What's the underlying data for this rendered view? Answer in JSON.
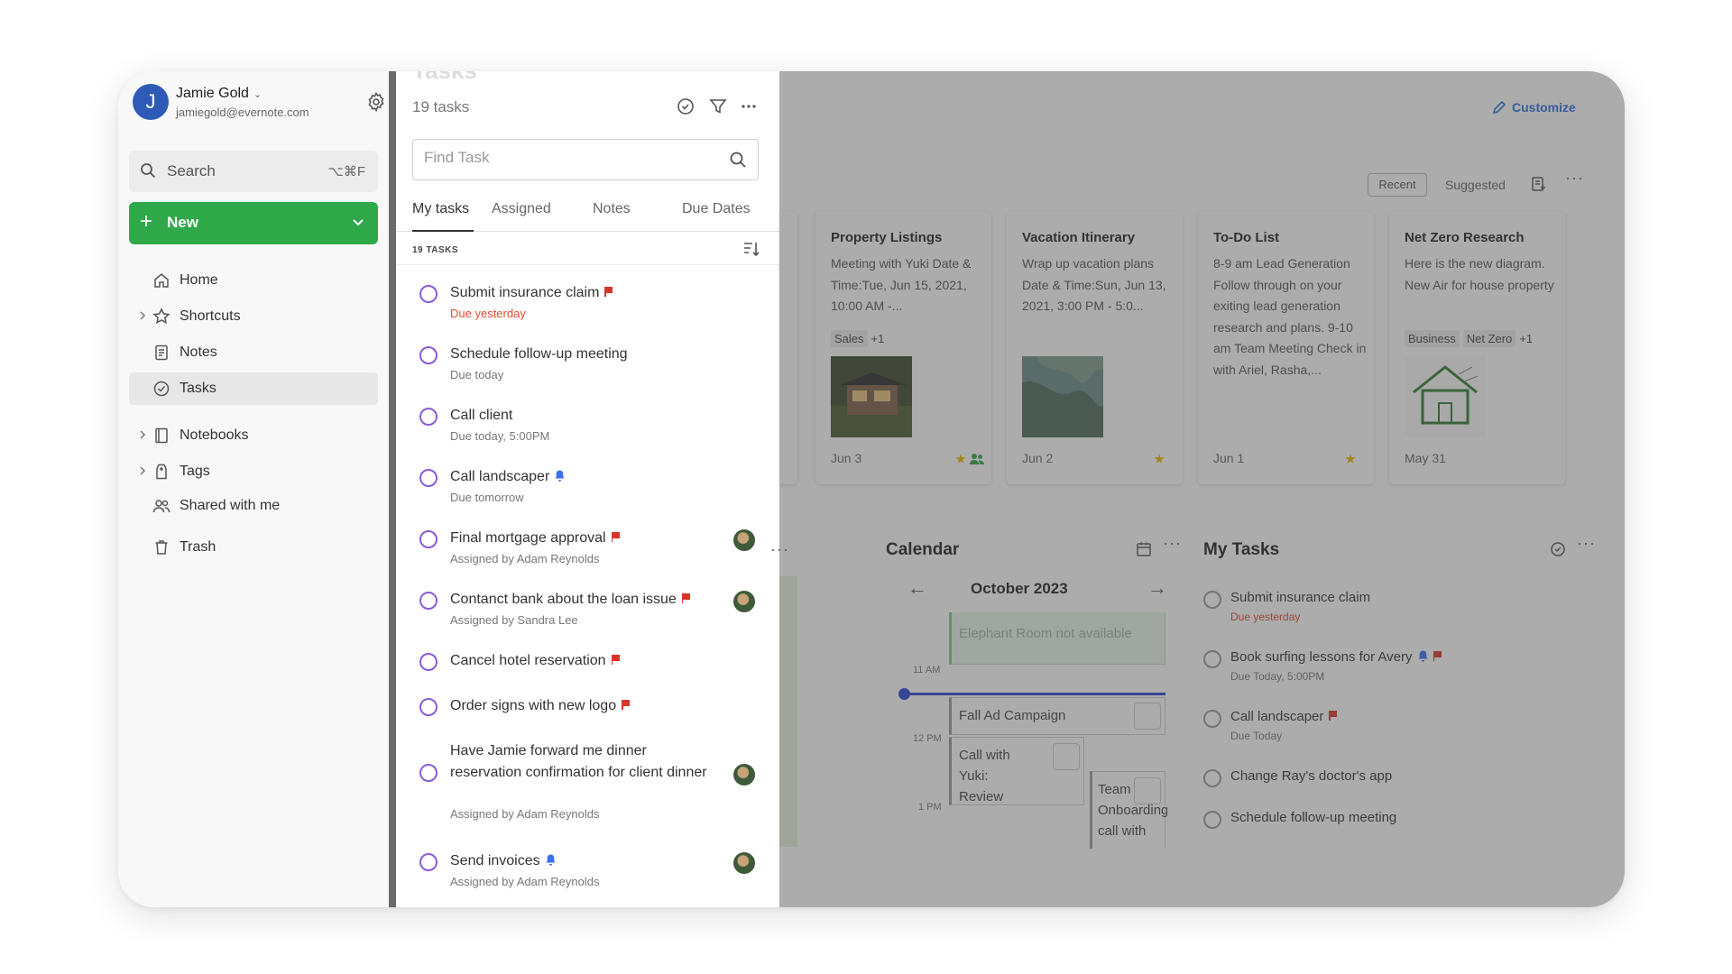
{
  "account": {
    "initial": "J",
    "name": "Jamie Gold",
    "email": "jamiegold@evernote.com"
  },
  "search": {
    "label": "Search",
    "shortcut": "⌥⌘F"
  },
  "new_button": {
    "label": "New"
  },
  "nav": [
    {
      "label": "Home",
      "icon": "home-icon"
    },
    {
      "label": "Shortcuts",
      "icon": "star-icon"
    },
    {
      "label": "Notes",
      "icon": "notes-icon"
    },
    {
      "label": "Tasks",
      "icon": "tasks-icon"
    },
    {
      "label": "Notebooks",
      "icon": "notebook-icon"
    },
    {
      "label": "Tags",
      "icon": "tag-icon"
    },
    {
      "label": "Shared with me",
      "icon": "people-icon"
    },
    {
      "label": "Trash",
      "icon": "trash-icon"
    }
  ],
  "tasks_panel": {
    "title": "Tasks",
    "count": "19 tasks",
    "find_placeholder": "Find Task",
    "tabs": [
      "My tasks",
      "Assigned",
      "Notes",
      "Due Dates"
    ],
    "list_header": "19 TASKS",
    "items": [
      {
        "title": "Submit insurance claim",
        "sub": "Due yesterday"
      },
      {
        "title": "Schedule follow-up meeting",
        "sub": "Due today"
      },
      {
        "title": "Call client",
        "sub": "Due today, 5:00PM"
      },
      {
        "title": "Call landscaper",
        "sub": "Due tomorrow"
      },
      {
        "title": "Final mortgage approval",
        "sub": "Assigned by Adam Reynolds"
      },
      {
        "title": "Contanct bank about the loan issue",
        "sub": "Assigned by Sandra Lee"
      },
      {
        "title": "Cancel hotel reservation",
        "sub": ""
      },
      {
        "title": "Order signs with new logo",
        "sub": ""
      },
      {
        "title": "Have Jamie forward me dinner reservation confirmation for client dinner",
        "sub": "Assigned by Adam Reynolds"
      },
      {
        "title": "Send invoices",
        "sub": "Assigned by Adam Reynolds"
      }
    ]
  },
  "home": {
    "customize": "Customize",
    "filters": [
      "Recent",
      "Suggested"
    ],
    "cards": [
      {
        "title": "Property Listings",
        "body": "Meeting with Yuki Date & Time:Tue, Jun 15, 2021, 10:00 AM -...",
        "tags": [
          "Sales",
          "+1"
        ],
        "date": "Jun 3"
      },
      {
        "title": "Vacation Itinerary",
        "body": "Wrap up vacation plans Date & Time:Sun, Jun 13, 2021, 3:00 PM - 5:0...",
        "tags": [],
        "date": "Jun 2"
      },
      {
        "title": "To-Do List",
        "body": "8-9 am Lead Generation Follow through on your exiting lead generation research and plans. 9-10 am Team Meeting Check in with Ariel, Rasha,...",
        "tags": [],
        "date": "Jun 1"
      },
      {
        "title": "Net Zero Research",
        "body": "Here is the new diagram. New Air for house property",
        "tags": [
          "Business",
          "Net Zero",
          "+1"
        ],
        "date": "May 31"
      }
    ],
    "calendar": {
      "title": "Calendar",
      "month": "October 2023",
      "times": [
        "11 AM",
        "12 PM",
        "1 PM"
      ],
      "events": [
        "Elephant Room not available",
        "Fall Ad Campaign",
        "Call with Yuki: Review",
        "Team Onboarding call with"
      ]
    },
    "my_tasks": {
      "title": "My Tasks",
      "items": [
        {
          "title": "Submit insurance claim",
          "sub": "Due yesterday"
        },
        {
          "title": "Book surfing lessons for Avery",
          "sub": "Due Today, 5:00PM"
        },
        {
          "title": "Call landscaper",
          "sub": "Due Today"
        },
        {
          "title": "Change Ray's doctor's app",
          "sub": ""
        },
        {
          "title": "Schedule follow-up meeting",
          "sub": ""
        }
      ]
    }
  },
  "colors": {
    "accent_green": "#2fa84a",
    "task_circle": "#8a5cd6",
    "flag_red": "#d8352a",
    "link_blue": "#2d6de0",
    "avatar_blue": "#2e5bb8"
  }
}
